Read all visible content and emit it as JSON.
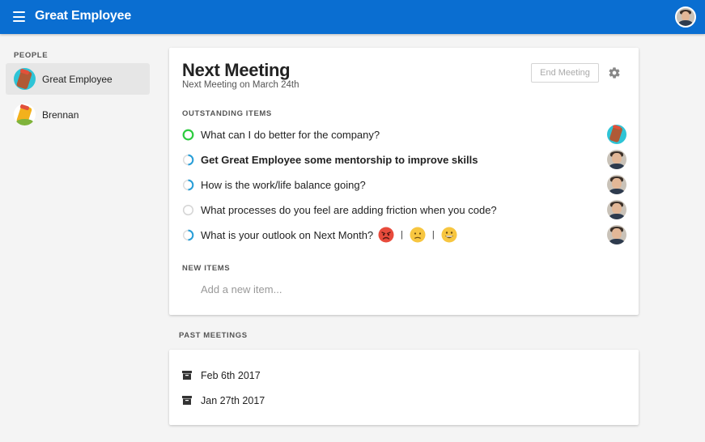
{
  "app": {
    "title": "Great Employee",
    "accent_color": "#0a6ed1"
  },
  "sidebar": {
    "section_label": "PEOPLE",
    "people": [
      {
        "name": "Great Employee",
        "avatar": "pencil-avatar-teal-brown",
        "active": true
      },
      {
        "name": "Brennan",
        "avatar": "pencil-avatar-yellow-red",
        "active": false
      }
    ]
  },
  "meeting": {
    "title": "Next Meeting",
    "subtitle": "Next Meeting on March 24th",
    "end_button_label": "End Meeting",
    "settings_icon": "gear-icon",
    "outstanding_label": "OUTSTANDING ITEMS",
    "items": [
      {
        "text": "What can I do better for the company?",
        "status": "complete",
        "bold": false,
        "owner": "pencil-avatar-teal-brown"
      },
      {
        "text": "Get Great Employee some mentorship to improve skills",
        "status": "in-progress",
        "bold": true,
        "owner": "photo-avatar"
      },
      {
        "text": "How is the work/life balance going?",
        "status": "in-progress",
        "bold": false,
        "owner": "photo-avatar"
      },
      {
        "text": "What processes do you feel are adding friction when you code?",
        "status": "not-started",
        "bold": false,
        "owner": "photo-avatar"
      },
      {
        "text": "What is your outlook on Next Month?",
        "status": "in-progress",
        "bold": false,
        "owner": "photo-avatar",
        "emojis": [
          "angry-face",
          "slightly-frowning-face",
          "grinning-face"
        ],
        "separator": "|"
      }
    ],
    "new_items_label": "NEW ITEMS",
    "new_item_placeholder": "Add a new item..."
  },
  "past_meetings": {
    "label": "PAST MEETINGS",
    "items": [
      {
        "date": "Feb 6th 2017",
        "icon": "archive-icon"
      },
      {
        "date": "Jan 27th 2017",
        "icon": "archive-icon"
      }
    ]
  }
}
